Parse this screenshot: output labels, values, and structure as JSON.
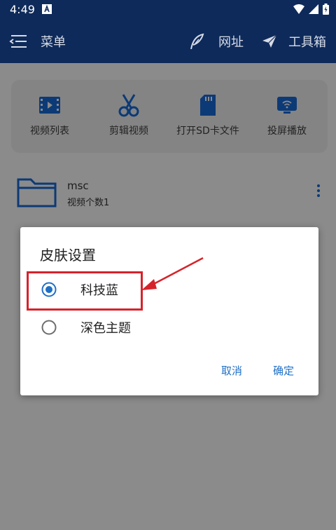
{
  "status_bar": {
    "time": "4:49"
  },
  "app_bar": {
    "menu_label": "菜单",
    "url_label": "网址",
    "toolbox_label": "工具箱"
  },
  "quick_actions": [
    {
      "label": "视频列表",
      "icon": "video-list-icon"
    },
    {
      "label": "剪辑视频",
      "icon": "scissors-icon"
    },
    {
      "label": "打开SD卡文件",
      "icon": "sd-card-icon"
    },
    {
      "label": "投屏播放",
      "icon": "cast-icon"
    }
  ],
  "folder": {
    "name": "msc",
    "count_text": "视频个数1"
  },
  "dialog": {
    "title": "皮肤设置",
    "options": [
      {
        "label": "科技蓝",
        "selected": true
      },
      {
        "label": "深色主题",
        "selected": false
      }
    ],
    "cancel_label": "取消",
    "ok_label": "确定"
  },
  "colors": {
    "app_bar": "#0e2a5a",
    "accent": "#1f6fc5",
    "annotation": "#d6232b"
  }
}
